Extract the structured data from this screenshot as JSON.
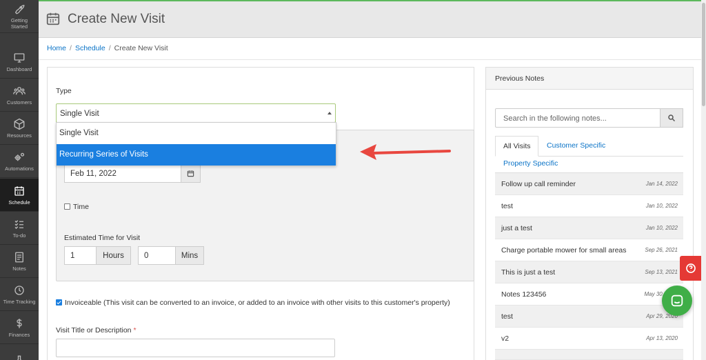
{
  "sidebar": {
    "items": [
      {
        "label": "Getting\nStarted",
        "icon": "rocket-icon"
      },
      {
        "label": "Dashboard",
        "icon": "monitor-icon"
      },
      {
        "label": "Customers",
        "icon": "users-icon"
      },
      {
        "label": "Resources",
        "icon": "box-icon"
      },
      {
        "label": "Automations",
        "icon": "gears-icon"
      },
      {
        "label": "Schedule",
        "icon": "calendar-icon",
        "active": true
      },
      {
        "label": "To-do",
        "icon": "checklist-icon"
      },
      {
        "label": "Notes",
        "icon": "notes-icon"
      },
      {
        "label": "Time Tracking",
        "icon": "clock-icon"
      },
      {
        "label": "Finances",
        "icon": "dollar-icon"
      },
      {
        "label": "",
        "icon": "flask-icon"
      }
    ]
  },
  "header": {
    "title": "Create New Visit"
  },
  "breadcrumb": {
    "home": "Home",
    "schedule": "Schedule",
    "current": "Create New Visit"
  },
  "form": {
    "type_label": "Type",
    "type_selected": "Single Visit",
    "type_options": [
      "Single Visit",
      "Recurring Series of Visits"
    ],
    "highlighted_option": "Recurring Series of Visits",
    "date_value": "Feb 11, 2022",
    "time_label": "Time",
    "time_checked": false,
    "estimated_label": "Estimated Time for Visit",
    "hours_value": "1",
    "hours_unit": "Hours",
    "mins_value": "0",
    "mins_unit": "Mins",
    "invoiceable_checked": true,
    "invoiceable_label": "Invoiceable (This visit can be converted to an invoice, or added to an invoice with other visits to this customer's property)",
    "visit_title_label": "Visit Title or Description",
    "required_marker": "*",
    "visit_title_value": ""
  },
  "notes_panel": {
    "title": "Previous Notes",
    "search_placeholder": "Search in the following notes...",
    "tabs": [
      "All Visits",
      "Customer Specific",
      "Property Specific"
    ],
    "active_tab": "All Visits",
    "notes": [
      {
        "text": "Follow up call reminder",
        "date": "Jan 14, 2022"
      },
      {
        "text": "test",
        "date": "Jan 10, 2022"
      },
      {
        "text": "just a test",
        "date": "Jan 10, 2022"
      },
      {
        "text": "Charge portable mower for small areas",
        "date": "Sep 26, 2021"
      },
      {
        "text": "This is just a test",
        "date": "Sep 13, 2021"
      },
      {
        "text": "Notes 123456",
        "date": "May 30, 2021"
      },
      {
        "text": "test",
        "date": "Apr 29, 2020"
      },
      {
        "text": "v2",
        "date": "Apr 13, 2020"
      }
    ]
  },
  "colors": {
    "accent_green": "#5cb85c",
    "link_blue": "#0a73c7",
    "highlight_blue": "#1a7fe0",
    "arrow_red": "#e8473f",
    "help_red": "#e53935",
    "chat_green": "#3fae47"
  }
}
